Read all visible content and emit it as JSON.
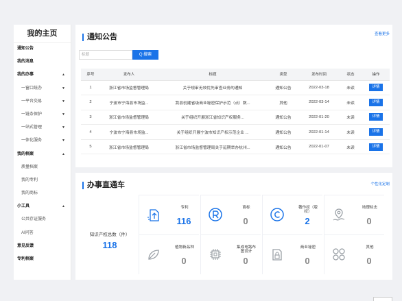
{
  "sidebar": {
    "title": "我的主页",
    "items": [
      {
        "label": "通知公告",
        "type": "bold",
        "arrow": ""
      },
      {
        "label": "我的消息",
        "type": "bold",
        "arrow": ""
      },
      {
        "label": "我的办事",
        "type": "bold",
        "arrow": "▲"
      },
      {
        "label": "一窗口统办",
        "type": "sub",
        "arrow": "▼"
      },
      {
        "label": "一平台交易",
        "type": "sub",
        "arrow": "▼"
      },
      {
        "label": "一链条保护",
        "type": "sub",
        "arrow": "▼"
      },
      {
        "label": "一站式管理",
        "type": "sub",
        "arrow": "▼"
      },
      {
        "label": "一体化服务",
        "type": "sub",
        "arrow": "▼"
      },
      {
        "label": "我的档案",
        "type": "bold",
        "arrow": "▲"
      },
      {
        "label": "质量档案",
        "type": "sub",
        "arrow": ""
      },
      {
        "label": "我的专利",
        "type": "sub",
        "arrow": ""
      },
      {
        "label": "我的商标",
        "type": "sub",
        "arrow": ""
      },
      {
        "label": "小工具",
        "type": "bold",
        "arrow": "▲"
      },
      {
        "label": "公共存证服务",
        "type": "sub",
        "arrow": ""
      },
      {
        "label": "AI问答",
        "type": "sub",
        "arrow": ""
      },
      {
        "label": "意见反馈",
        "type": "bold",
        "arrow": ""
      },
      {
        "label": "专利档案",
        "type": "bold",
        "arrow": ""
      }
    ]
  },
  "notice": {
    "title": "通知公告",
    "more": "查看更多",
    "search_placeholder": "标题",
    "search_btn": "Q 搜索",
    "columns": [
      "序号",
      "发布人",
      "标题",
      "类型",
      "发布时间",
      "状态",
      "操作"
    ],
    "rows": [
      {
        "no": "1",
        "publisher": "浙江省市场监督管理局",
        "title": "关于规审无效优先审查业务的通知",
        "type": "通知公告",
        "date": "2022-03-18",
        "status": "未读",
        "action": "详情"
      },
      {
        "no": "2",
        "publisher": "宁波市宁海县市场监...",
        "title": "我县创建省级商业秘密保护示范（点）数...",
        "type": "其他",
        "date": "2022-03-14",
        "status": "未读",
        "action": "详情"
      },
      {
        "no": "3",
        "publisher": "浙江省市场监督管理局",
        "title": "关于组织开展浙江省知识产权服务...",
        "type": "通知公告",
        "date": "2022-01-20",
        "status": "未读",
        "action": "详情"
      },
      {
        "no": "4",
        "publisher": "宁波市宁海县市场监...",
        "title": "关于组织开展宁波市知识产权示范企业 ...",
        "type": "通知公告",
        "date": "2022-01-14",
        "status": "未读",
        "action": "详情"
      },
      {
        "no": "5",
        "publisher": "浙江省市场监督管理局",
        "title": "浙江省市场监督管理局关于延期举办杭州...",
        "type": "通知公告",
        "date": "2022-01-07",
        "status": "未读",
        "action": "详情"
      }
    ]
  },
  "service": {
    "title": "办事直通车",
    "custom": "个性化定制",
    "total_label": "知识产权总数（件）",
    "total_value": "118",
    "cards": [
      {
        "label": "专利",
        "value": "116",
        "icon": "patent-icon"
      },
      {
        "label": "商标",
        "value": "0",
        "icon": "trademark-icon"
      },
      {
        "label": "著作权（版权）",
        "value": "2",
        "icon": "copyright-icon"
      },
      {
        "label": "地理标志",
        "value": "0",
        "icon": "geo-mark-icon"
      },
      {
        "label": "植物新品种",
        "value": "0",
        "icon": "plant-icon"
      },
      {
        "label": "集成电路布图设计",
        "value": "0",
        "icon": "chip-icon"
      },
      {
        "label": "商业秘密",
        "value": "0",
        "icon": "trade-secret-icon"
      },
      {
        "label": "其他",
        "value": "0",
        "icon": "other-icon"
      }
    ]
  },
  "colors": {
    "accent": "#1a73e8",
    "icon_gray": "#9aa0a6"
  }
}
